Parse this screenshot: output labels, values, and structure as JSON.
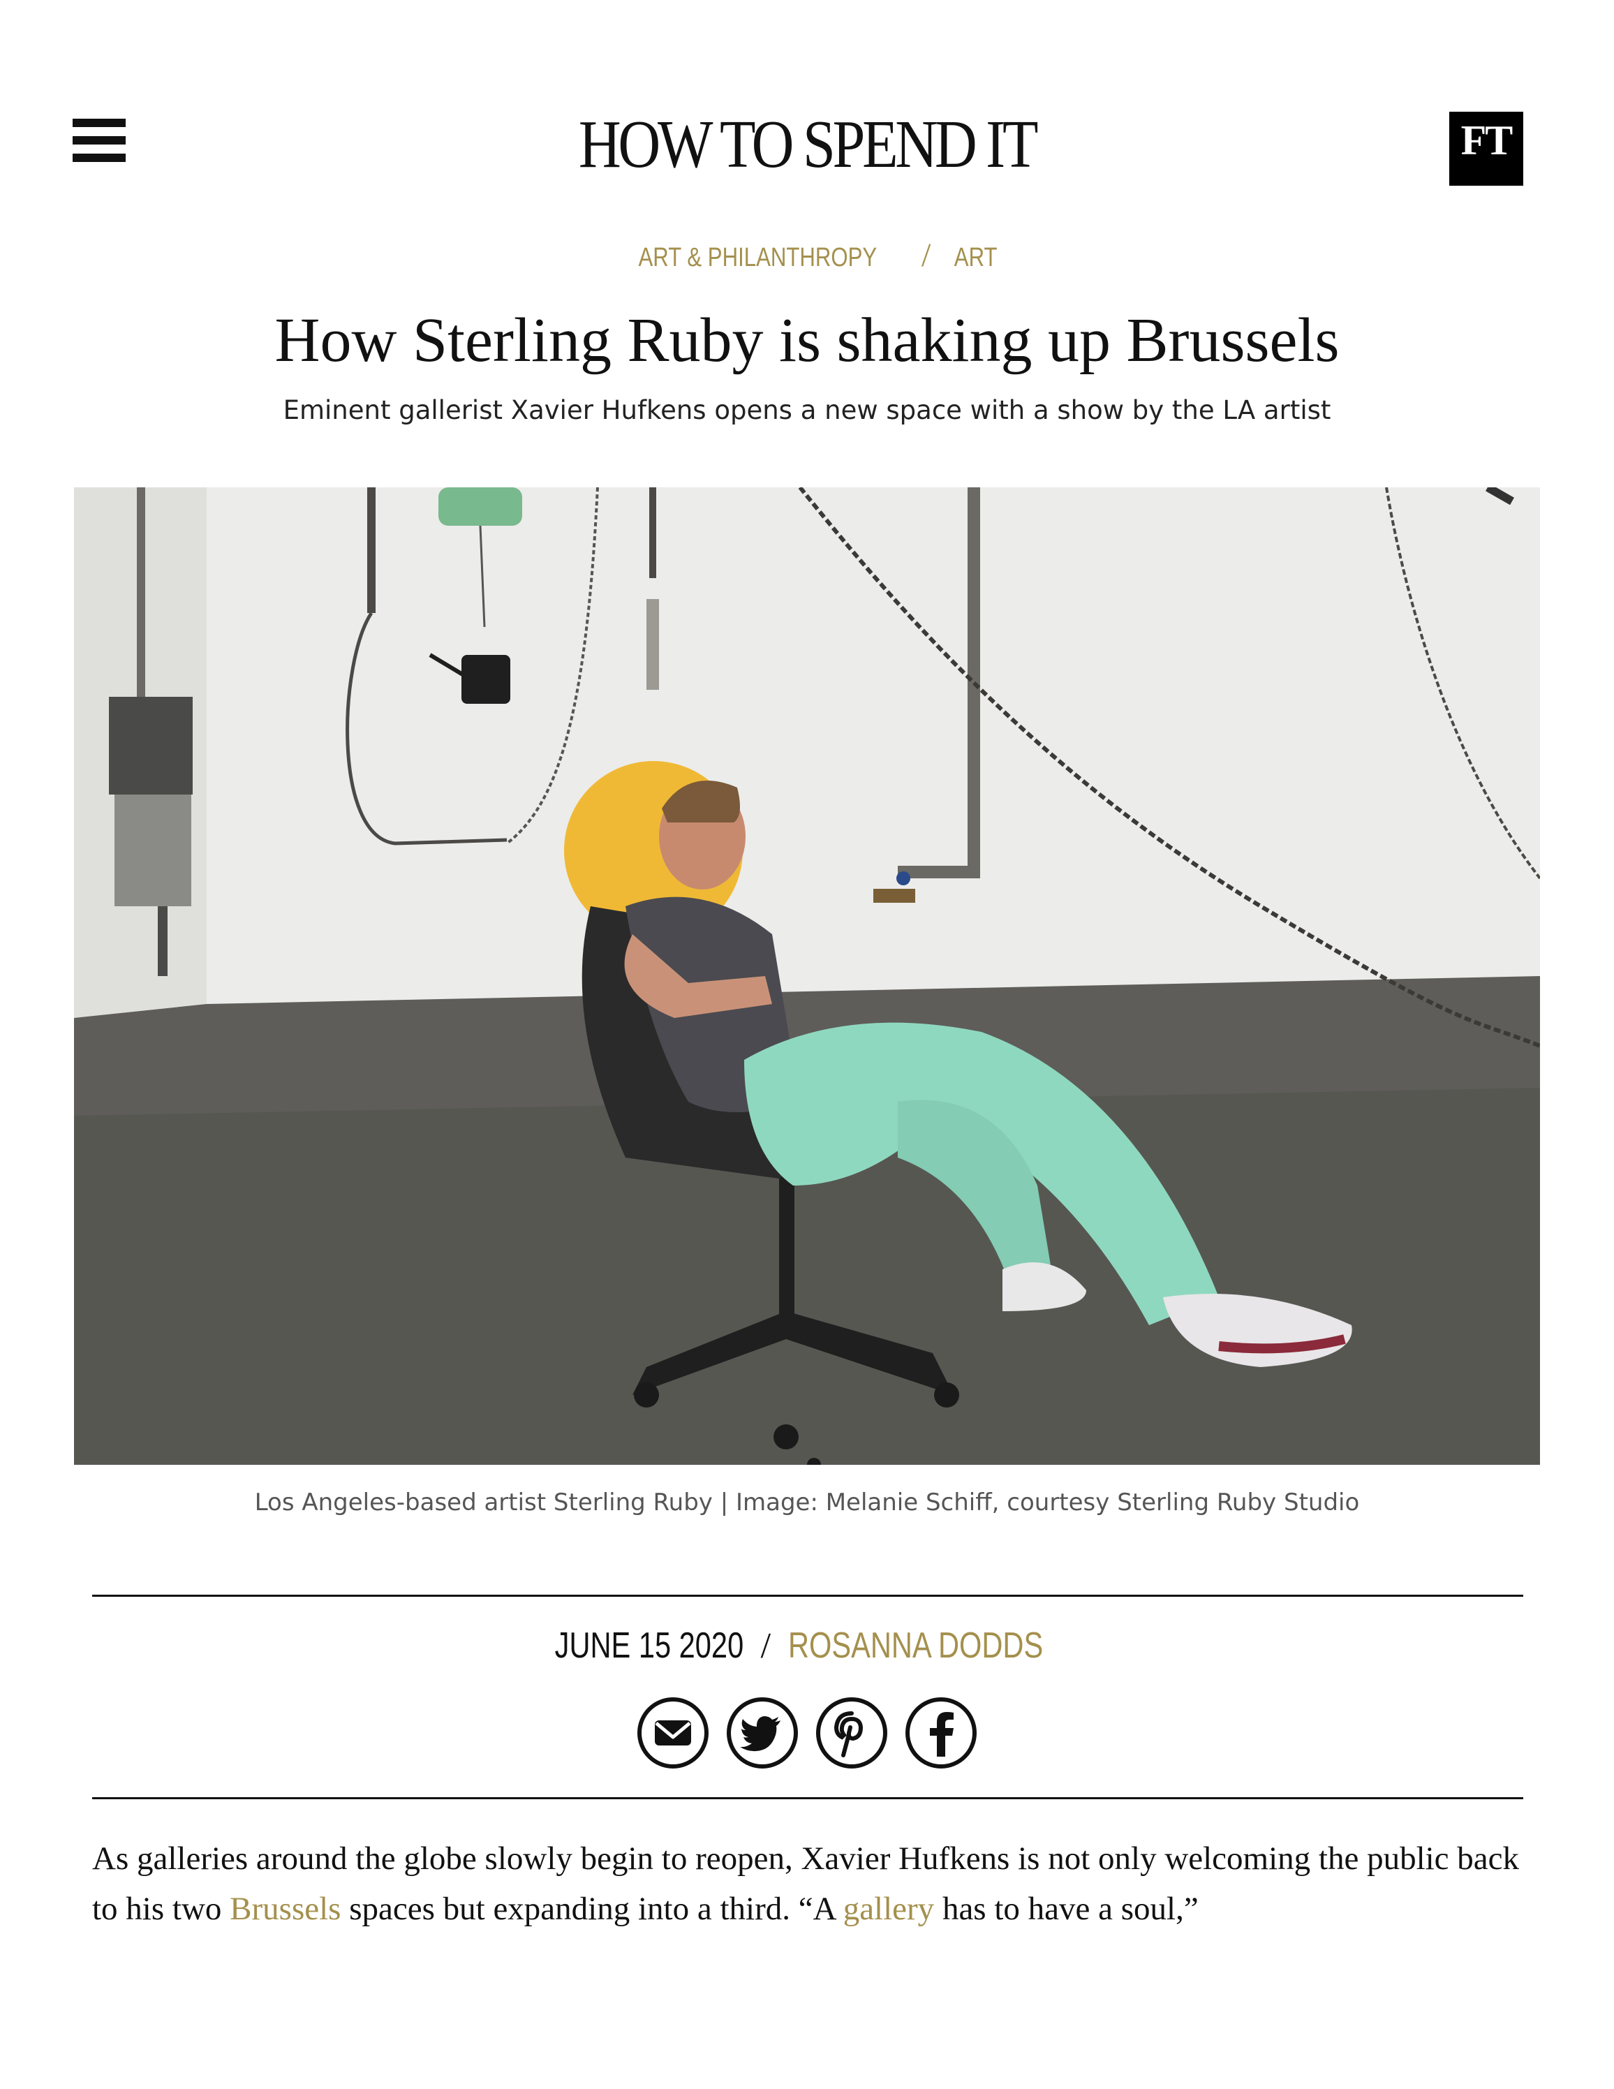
{
  "header": {
    "masthead": "HOW TO SPEND IT",
    "ft_logo": "FT",
    "menu_icon": "hamburger-menu-icon"
  },
  "breadcrumb": {
    "items": [
      "ART & PHILANTHROPY",
      "ART"
    ],
    "separator": "/"
  },
  "article": {
    "title": "How Sterling Ruby is shaking up Brussels",
    "standfirst": "Eminent gallerist Xavier Hufkens opens a new space with a show by the LA artist",
    "image_caption": "Los Angeles-based artist Sterling Ruby | Image: Melanie Schiff, courtesy Sterling Ruby Studio",
    "date": "JUNE 15 2020",
    "byline_separator": "/",
    "author": "ROSANNA DODDS",
    "body": {
      "p1_a": "As galleries around the globe slowly begin to reopen, Xavier Hufkens is not only welcoming the public back to his two ",
      "p1_link1": "Brussels",
      "p1_b": " spaces but expanding into a third. “A ",
      "p1_link2": "gallery",
      "p1_c": " has to have a soul,”"
    }
  },
  "share": {
    "icons": [
      "email-icon",
      "twitter-icon",
      "pinterest-icon",
      "facebook-icon"
    ]
  },
  "colors": {
    "accent_gold": "#a4904d",
    "text": "#111111",
    "caption_grey": "#555555"
  }
}
